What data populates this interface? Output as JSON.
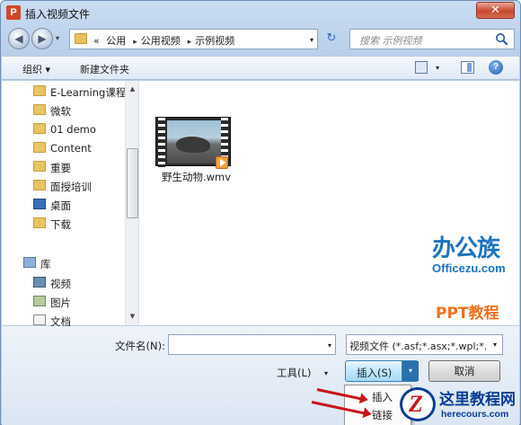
{
  "window": {
    "title": "插入视频文件",
    "app_icon": "P",
    "close_glyph": "✕"
  },
  "nav": {
    "back_glyph": "◀",
    "forward_glyph": "▶",
    "history_glyph": "▾",
    "breadcrumb": [
      "«",
      "公用",
      "公用视频",
      "示例视频"
    ],
    "crumb_sep": "▸",
    "dropdown_glyph": "▾",
    "refresh_glyph": "↻",
    "search_placeholder": "搜索 示例视频"
  },
  "toolbar": {
    "organize": "组织 ▾",
    "new_folder": "新建文件夹",
    "view_arrow": "▾",
    "help": "?"
  },
  "tree": [
    {
      "label": "E-Learning课程",
      "icon": "folder-icon"
    },
    {
      "label": "微软",
      "icon": "folder-icon"
    },
    {
      "label": "01 demo",
      "icon": "folder-icon"
    },
    {
      "label": "Content",
      "icon": "folder-icon"
    },
    {
      "label": "重要",
      "icon": "folder-icon"
    },
    {
      "label": "面授培训",
      "icon": "folder-icon"
    },
    {
      "label": "桌面",
      "icon": "desktop-icon"
    },
    {
      "label": "下载",
      "icon": "downloads-icon"
    },
    {
      "label": "库",
      "icon": "library-icon"
    },
    {
      "label": "视频",
      "icon": "video-library-icon"
    },
    {
      "label": "图片",
      "icon": "pictures-library-icon"
    },
    {
      "label": "文档",
      "icon": "documents-library-icon"
    }
  ],
  "scroll": {
    "up": "▲",
    "down": "▼"
  },
  "files": [
    {
      "name": "野生动物.wmv",
      "icon": "video-file-icon"
    }
  ],
  "watermark1": {
    "cn": "办公族",
    "url": "Officezu.com",
    "ppt": "PPT教程"
  },
  "bottom": {
    "filename_label": "文件名(N):",
    "filename_value": "",
    "filename_arrow": "▾",
    "filetype_value": "视频文件 (*.asf;*.asx;*.wpl;*.wm",
    "filetype_arrow": "▾",
    "tools": "工具(L)",
    "tools_arrow": "▾",
    "insert": "插入(S)",
    "insert_split": "▾",
    "cancel": "取消"
  },
  "menu": {
    "items": [
      "插入",
      "链接"
    ]
  },
  "watermark2": {
    "cn": "这里教程网",
    "url": "herecours.com"
  },
  "colors": {
    "accent": "#1b73c0",
    "brand_orange": "#f07020",
    "arrow_red": "#c8151b",
    "wm2_blue": "#0a3c96"
  }
}
